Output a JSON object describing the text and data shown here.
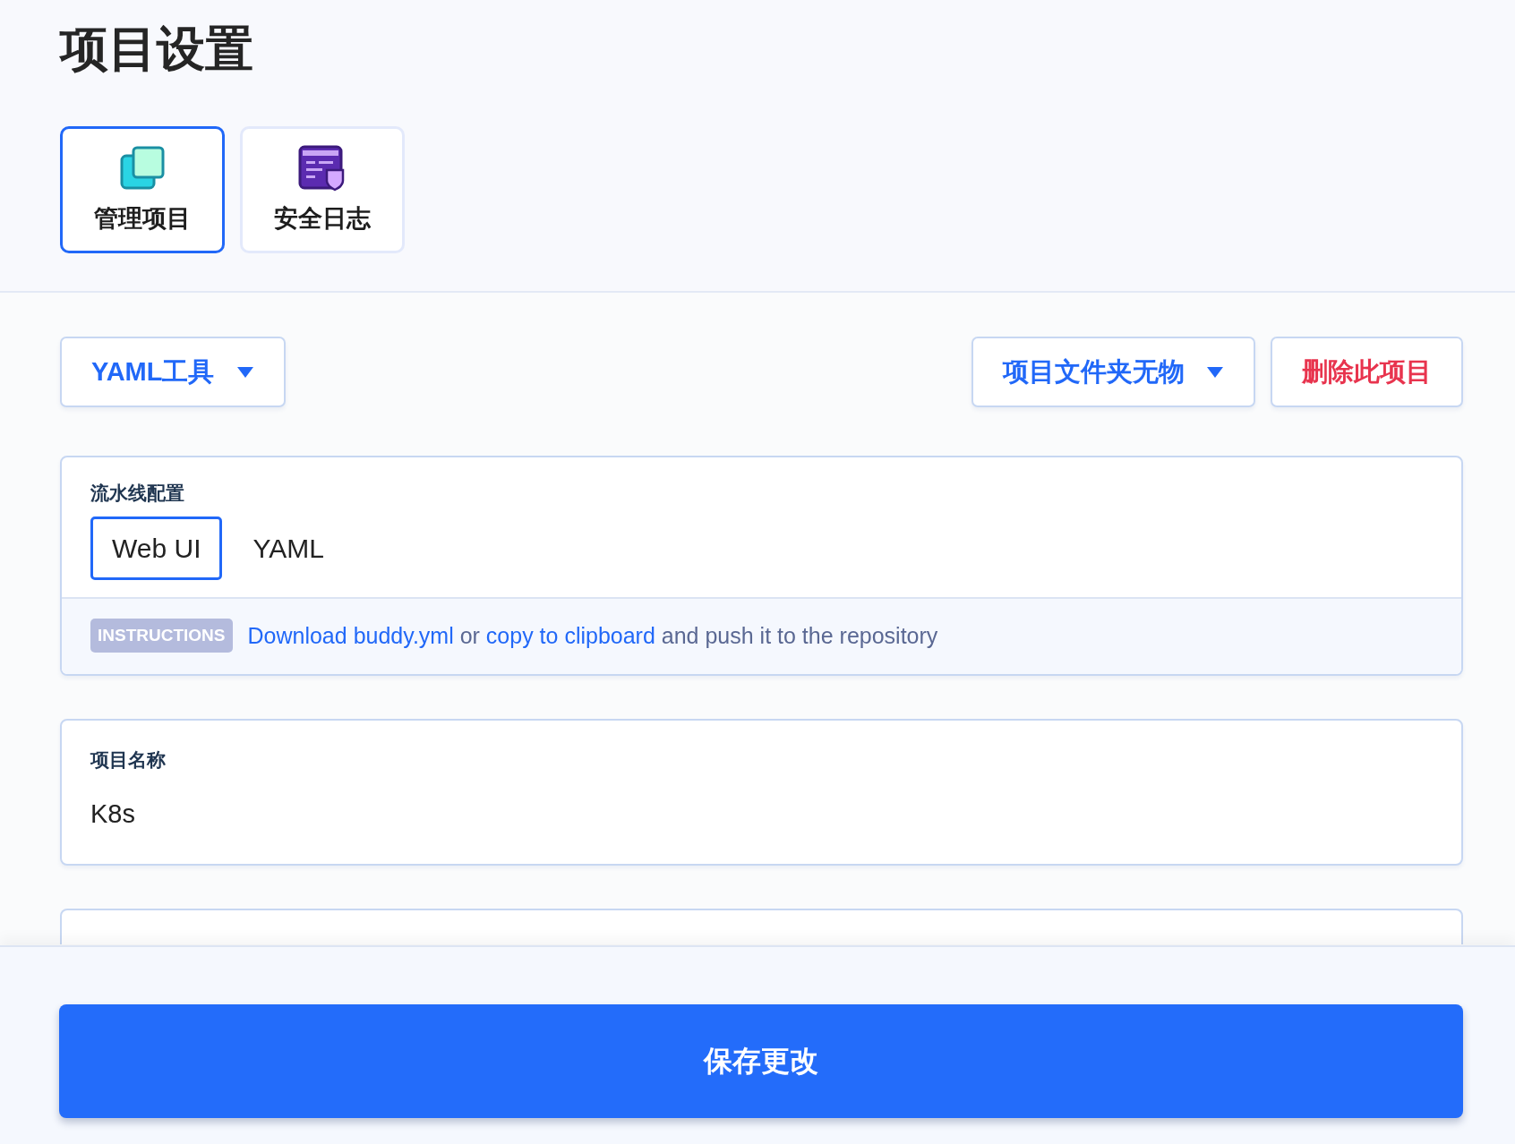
{
  "title": "项目设置",
  "tabs": [
    {
      "label": "管理项目",
      "kind": "squares",
      "selected": true
    },
    {
      "label": "安全日志",
      "kind": "log",
      "selected": false
    }
  ],
  "toolbar": {
    "left": [
      {
        "label": "YAML工具",
        "kind": "dropdown"
      }
    ],
    "right": [
      {
        "label": "项目文件夹无物",
        "kind": "dropdown"
      },
      {
        "label": "删除此项目",
        "kind": "danger"
      }
    ]
  },
  "pipeline": {
    "label": "流水线配置",
    "options": [
      {
        "label": "Web UI",
        "selected": true
      },
      {
        "label": "YAML",
        "selected": false
      }
    ],
    "badge": "INSTRUCTIONS",
    "instructions": [
      {
        "text": "Download buddy.yml",
        "kind": "link"
      },
      {
        "text": " or ",
        "kind": "text"
      },
      {
        "text": "copy to clipboard",
        "kind": "link"
      },
      {
        "text": " and push it to the repository",
        "kind": "text"
      }
    ]
  },
  "fields": [
    {
      "label": "项目名称",
      "value": "K8s"
    }
  ],
  "save_button": "保存更改"
}
